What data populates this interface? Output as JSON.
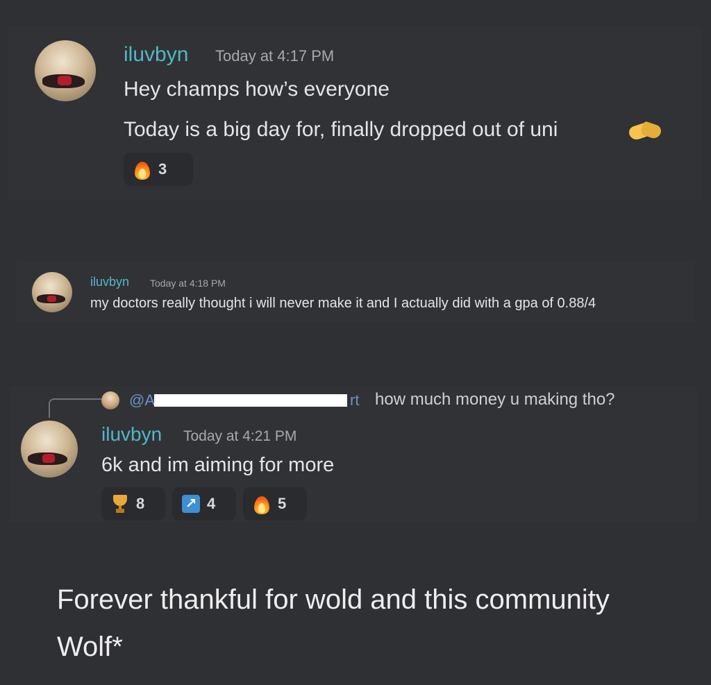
{
  "messages": [
    {
      "username": "iluvbyn",
      "time": "Today at 4:17 PM",
      "lines": [
        "Hey champs how’s everyone",
        "Today is a big day for, finally dropped out of uni"
      ],
      "reactions": [
        {
          "icon": "fire-icon",
          "count": "3"
        }
      ]
    },
    {
      "username": "iluvbyn",
      "time": "Today at 4:18 PM",
      "lines": [
        "my doctors really thought i will never make it and I actually did with a gpa of 0.88/4"
      ]
    },
    {
      "reply": {
        "mention_start": "@A",
        "mention_end": "rt",
        "text": "how much money u making tho?"
      },
      "username": "iluvbyn",
      "time": "Today at 4:21 PM",
      "lines": [
        "6k and im aiming for more"
      ],
      "reactions": [
        {
          "icon": "trophy-icon",
          "count": "8"
        },
        {
          "icon": "arrow-up-right-icon",
          "count": "4"
        },
        {
          "icon": "fire-icon",
          "count": "5"
        }
      ]
    }
  ],
  "caption": {
    "line1": "Forever thankful for wold and this community",
    "line2": "Wolf*"
  }
}
